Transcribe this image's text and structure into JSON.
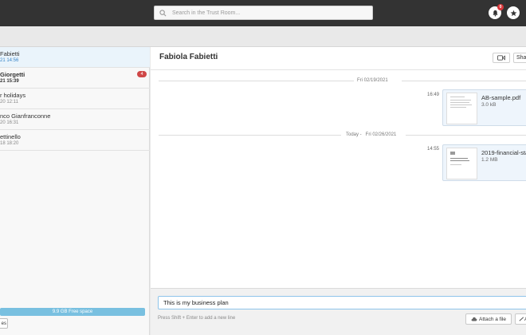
{
  "topbar": {
    "search_placeholder": "Search in the Trust Room...",
    "notifications_count": "0"
  },
  "sidebar": {
    "conversations": [
      {
        "name": "Fabietti",
        "date": "21 14:56",
        "active": true
      },
      {
        "name": "Giorgetti",
        "date": "21 15:39",
        "unread": "4"
      },
      {
        "name": "r holidays",
        "date": "20 12:11"
      },
      {
        "name": "nco Gianfranconne",
        "date": "20 16:31"
      },
      {
        "name": "ettinello",
        "date": "18 18:20"
      }
    ],
    "free_space": "9.9 GB Free space",
    "bottom_button": "es"
  },
  "chat": {
    "title": "Fabiola Fabietti",
    "share_label": "Sha",
    "separators": [
      {
        "label": "Fri 02/19/2021"
      },
      {
        "label": "Today -   Fri 02/26/2021"
      }
    ],
    "messages": [
      {
        "time": "16:49",
        "file_name": "AB-sample.pdf",
        "file_size": "3.0 kB"
      },
      {
        "time": "14:55",
        "file_name": "2019-financial-sta",
        "file_size": "1.2 MB"
      }
    ]
  },
  "composer": {
    "message_value": "This is my business plan",
    "hint": "Press Shift + Enter to add a new line",
    "attach_label": "Attach a file",
    "second_label": "A"
  },
  "colors": {
    "topbar": "#333333",
    "active_conversation": "#eaf4fb",
    "badge": "#cf4747",
    "free_space_bar": "#79c0e0",
    "file_card": "#eef5fc"
  }
}
